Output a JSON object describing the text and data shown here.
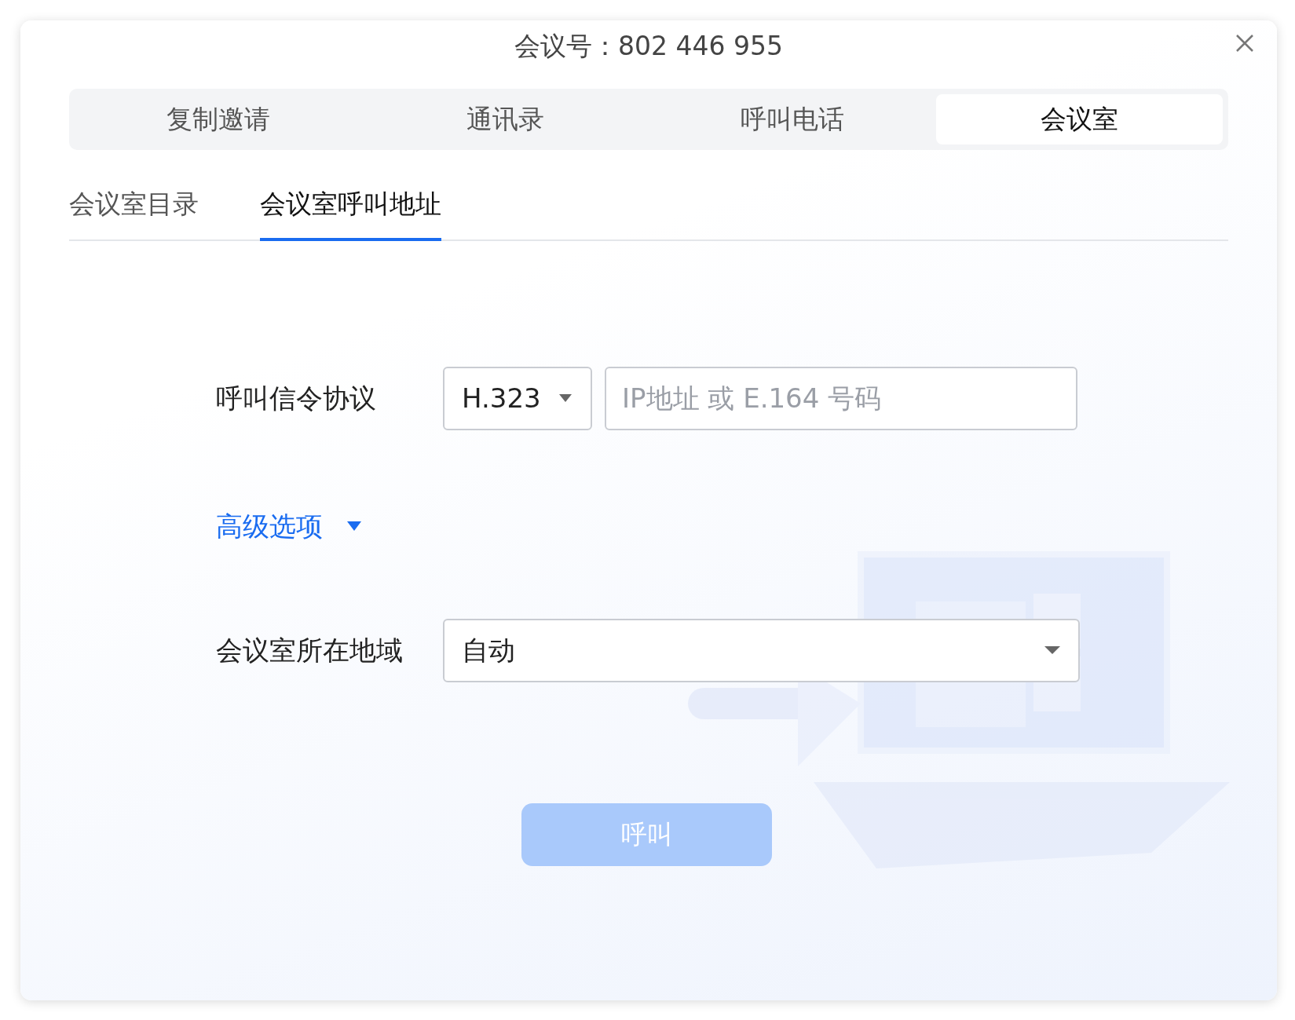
{
  "window": {
    "title": "会议号：802 446 955"
  },
  "tabs": [
    {
      "label": "复制邀请",
      "selected": false
    },
    {
      "label": "通讯录",
      "selected": false
    },
    {
      "label": "呼叫电话",
      "selected": false
    },
    {
      "label": "会议室",
      "selected": true
    }
  ],
  "subtabs": [
    {
      "label": "会议室目录",
      "selected": false
    },
    {
      "label": "会议室呼叫地址",
      "selected": true
    }
  ],
  "form": {
    "protocol": {
      "label": "呼叫信令协议",
      "value": "H.323",
      "placeholder": "IP地址 或 E.164 号码"
    },
    "advanced": {
      "label": "高级选项"
    },
    "region": {
      "label": "会议室所在地域",
      "value": "自动"
    }
  },
  "call_button": {
    "label": "呼叫",
    "disabled": true
  }
}
